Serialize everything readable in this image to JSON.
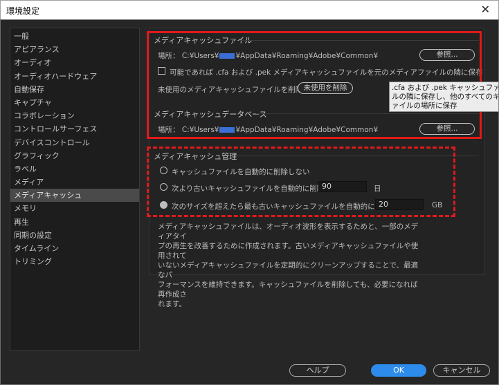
{
  "window": {
    "title": "環境設定",
    "close_glyph": "✕"
  },
  "sidebar": {
    "items": [
      {
        "label": "一般"
      },
      {
        "label": "アピアランス"
      },
      {
        "label": "オーディオ"
      },
      {
        "label": "オーディオハードウェア"
      },
      {
        "label": "自動保存"
      },
      {
        "label": "キャプチャ"
      },
      {
        "label": "コラボレーション"
      },
      {
        "label": "コントロールサーフェス"
      },
      {
        "label": "デバイスコントロール"
      },
      {
        "label": "グラフィック"
      },
      {
        "label": "ラベル"
      },
      {
        "label": "メディア"
      },
      {
        "label": "メディアキャッシュ"
      },
      {
        "label": "メモリ"
      },
      {
        "label": "再生"
      },
      {
        "label": "同期の設定"
      },
      {
        "label": "タイムライン"
      },
      {
        "label": "トリミング"
      }
    ],
    "selected": "メディアキャッシュ"
  },
  "cache_files": {
    "title": "メディアキャッシュファイル",
    "location_label": "場所：",
    "path_prefix": "C:¥Users¥",
    "path_suffix": "¥AppData¥Roaming¥Adobe¥Common¥",
    "browse_label": "参照...",
    "save_next_label": "可能であれば .cfa および .pek メディアキャッシュファイルを元のメディアファイルの隣に保存",
    "save_next_checked": false,
    "remove_unused_text": "未使用のメディアキャッシュファイルを削除",
    "remove_unused_button": "未使用を削除"
  },
  "cache_database": {
    "title": "メディアキャッシュデータベース",
    "location_label": "場所：",
    "path_prefix": "C:¥Users¥",
    "path_suffix": "¥AppData¥Roaming¥Adobe¥Common¥",
    "browse_label": "参照..."
  },
  "cache_management": {
    "title": "メディアキャッシュ管理",
    "option_no_delete": "キャッシュファイルを自動的に削除しない",
    "option_older_than": "次より古いキャッシュファイルを自動的に削除：",
    "older_than_value": "90",
    "older_than_unit": "日",
    "option_exceeds_size": "次のサイズを超えたら最も古いキャッシュファイルを自動的に削除：",
    "exceeds_size_value": "20",
    "exceeds_size_unit": "GB",
    "selected_option": "exceeds_size"
  },
  "description": {
    "lines": [
      "メディアキャッシュファイルは、オーディオ波形を表示するためと、一部のメディアタイ",
      "プの再生を改善するために作成されます。古いメディアキャッシュファイルや使用されて",
      "いないメディアキャッシュファイルを定期的にクリーンアップすることで、最適なパ",
      "フォーマンスを維持できます。キャッシュファイルを削除しても、必要になれば再作成さ",
      "れます。"
    ]
  },
  "tooltip": {
    "lines": [
      ".cfa および .pek キャッシュファイルは、",
      "ルの隣に保存し、他のすべてのキャッシュ",
      "ァイルの場所に保存"
    ]
  },
  "footer": {
    "help_label": "ヘルプ",
    "ok_label": "OK",
    "cancel_label": "キャンセル"
  },
  "colors": {
    "accent": "#2d8ceb",
    "highlight_red": "#e01a1a",
    "redaction": "#3c6fd6"
  }
}
